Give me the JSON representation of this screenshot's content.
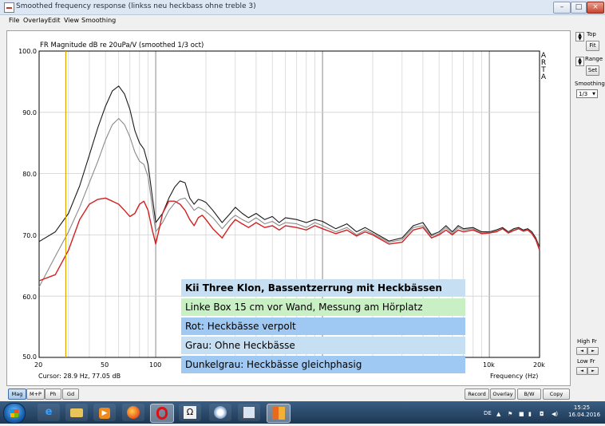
{
  "window": {
    "title": "Smoothed frequency response (linkss neu heckbass ohne treble 3)",
    "minimize": "–",
    "maximize": "□",
    "close": "×"
  },
  "menu": [
    "File",
    "Overlay",
    "Edit",
    "View",
    "Smoothing"
  ],
  "chart_data": {
    "type": "line",
    "title": "FR Magnitude dB re 20uPa/V (smoothed 1/3 oct)",
    "xlabel": "Frequency (Hz)",
    "ylabel": "",
    "x_scale": "log",
    "xlim": [
      20,
      20000
    ],
    "ylim": [
      50,
      100
    ],
    "ytick_labels": [
      "100.0",
      "90.0",
      "80.0",
      "70.0",
      "60.0",
      "50.0"
    ],
    "ytick_values": [
      100,
      90,
      80,
      70,
      60,
      50
    ],
    "xtick_labels": [
      "20",
      "50",
      "100",
      "10k",
      "20k"
    ],
    "xtick_values": [
      20,
      50,
      100,
      10000,
      20000
    ],
    "grid": true,
    "cursor_line_hz": 28.9,
    "series": [
      {
        "color": "#1a1a1a",
        "x": [
          20,
          25,
          30,
          35,
          40,
          45,
          50,
          55,
          60,
          65,
          70,
          75,
          80,
          85,
          90,
          100,
          110,
          120,
          130,
          140,
          150,
          160,
          170,
          180,
          190,
          200,
          220,
          250,
          280,
          300,
          330,
          360,
          400,
          450,
          500,
          550,
          600,
          700,
          800,
          900,
          1000,
          1200,
          1400,
          1600,
          1800,
          2000,
          2500,
          3000,
          3500,
          4000,
          4500,
          5000,
          5500,
          6000,
          6500,
          7000,
          8000,
          9000,
          10000,
          11000,
          12000,
          13000,
          14000,
          15000,
          16000,
          17000,
          18000,
          19000,
          20000
        ],
        "y": [
          68.9,
          70.5,
          73.5,
          78.0,
          83.0,
          87.5,
          91.0,
          93.5,
          94.3,
          93.0,
          90.5,
          87.0,
          85.0,
          84.0,
          81.5,
          72.0,
          73.5,
          76.0,
          77.8,
          78.8,
          78.5,
          76.0,
          75.0,
          75.8,
          75.6,
          75.3,
          74.0,
          72.0,
          73.5,
          74.5,
          73.5,
          72.8,
          73.5,
          72.5,
          73.0,
          72.0,
          72.8,
          72.5,
          72.0,
          72.5,
          72.2,
          71.0,
          71.8,
          70.5,
          71.2,
          70.5,
          69.0,
          69.5,
          71.5,
          72.0,
          70.0,
          70.5,
          71.5,
          70.5,
          71.5,
          71.0,
          71.2,
          70.5,
          70.5,
          70.8,
          71.2,
          70.5,
          71.0,
          71.2,
          70.8,
          71.0,
          70.5,
          69.5,
          68.0
        ]
      },
      {
        "color": "#8a8a8a",
        "x": [
          20,
          25,
          30,
          35,
          40,
          45,
          50,
          55,
          60,
          65,
          70,
          75,
          80,
          85,
          90,
          100,
          110,
          120,
          130,
          140,
          150,
          160,
          170,
          180,
          190,
          200,
          220,
          250,
          280,
          300,
          330,
          360,
          400,
          450,
          500,
          550,
          600,
          700,
          800,
          900,
          1000,
          1200,
          1400,
          1600,
          1800,
          2000,
          2500,
          3000,
          3500,
          4000,
          4500,
          5000,
          5500,
          6000,
          6500,
          7000,
          8000,
          9000,
          10000,
          11000,
          12000,
          13000,
          14000,
          15000,
          16000,
          17000,
          18000,
          19000,
          20000
        ],
        "y": [
          61.5,
          66.5,
          70.5,
          74.5,
          78.5,
          82.0,
          85.5,
          88.0,
          89.0,
          88.0,
          86.0,
          83.5,
          82.0,
          81.5,
          79.5,
          70.5,
          72.0,
          74.0,
          75.2,
          75.8,
          76.0,
          75.0,
          74.0,
          74.5,
          74.2,
          73.8,
          72.8,
          71.0,
          72.5,
          73.2,
          72.5,
          72.0,
          72.8,
          71.8,
          72.2,
          71.5,
          72.0,
          71.8,
          71.2,
          72.0,
          71.5,
          70.5,
          71.2,
          70.0,
          70.8,
          70.2,
          68.8,
          69.2,
          71.2,
          71.5,
          69.8,
          70.2,
          71.2,
          70.2,
          71.2,
          70.8,
          71.0,
          70.3,
          70.4,
          70.6,
          71.0,
          70.4,
          70.8,
          71.0,
          70.6,
          70.8,
          70.3,
          69.3,
          67.8
        ]
      },
      {
        "color": "#d42020",
        "x": [
          20,
          25,
          30,
          35,
          40,
          45,
          50,
          55,
          60,
          65,
          70,
          75,
          80,
          85,
          90,
          95,
          100,
          105,
          110,
          120,
          130,
          140,
          150,
          160,
          170,
          180,
          190,
          200,
          220,
          250,
          280,
          300,
          330,
          360,
          400,
          450,
          500,
          550,
          600,
          700,
          800,
          900,
          1000,
          1200,
          1400,
          1600,
          1800,
          2000,
          2500,
          3000,
          3500,
          4000,
          4500,
          5000,
          5500,
          6000,
          6500,
          7000,
          8000,
          9000,
          10000,
          11000,
          12000,
          13000,
          14000,
          15000,
          16000,
          17000,
          18000,
          19000,
          20000
        ],
        "y": [
          62.5,
          63.5,
          67.5,
          72.5,
          75.0,
          75.8,
          76.0,
          75.5,
          75.0,
          74.0,
          73.0,
          73.5,
          75.0,
          75.5,
          74.0,
          71.0,
          68.5,
          71.0,
          73.5,
          75.5,
          75.5,
          75.0,
          74.0,
          72.5,
          71.5,
          72.8,
          73.2,
          72.5,
          71.0,
          69.5,
          71.5,
          72.5,
          71.8,
          71.2,
          72.0,
          71.2,
          71.5,
          70.8,
          71.5,
          71.2,
          70.8,
          71.5,
          71.0,
          70.2,
          70.8,
          69.8,
          70.5,
          70.0,
          68.5,
          68.8,
          70.8,
          71.2,
          69.5,
          70.0,
          70.8,
          70.0,
          70.8,
          70.5,
          70.8,
          70.2,
          70.3,
          70.5,
          71.0,
          70.3,
          70.7,
          71.0,
          70.6,
          70.8,
          70.2,
          69.2,
          67.5
        ]
      }
    ]
  },
  "plot": {
    "arta_letters": [
      "A",
      "R",
      "T",
      "A"
    ],
    "cursor_readout": "Cursor: 28.9 Hz, 77.05 dB",
    "annotations": [
      "Kii Three Klon, Bassentzerrung mit Heckbässen",
      "Linke Box 15 cm vor Wand, Messung am Hörplatz",
      "Rot: Heckbässe verpolt",
      "Grau: Ohne Heckbässe",
      "Dunkelgrau: Heckbässe gleichphasig"
    ]
  },
  "right_panel": {
    "top_label": "Top",
    "fit_label": "Fit",
    "range_label": "Range",
    "set_label": "Set",
    "smoothing_label": "Smoothing",
    "smoothing_value": "1/3",
    "high_fr_label": "High Fr",
    "low_fr_label": "Low Fr"
  },
  "bottom_tabs": [
    "Mag",
    "M+P",
    "Ph",
    "Gd"
  ],
  "bottom_buttons": [
    "Record",
    "Overlay",
    "B/W",
    "Copy"
  ],
  "taskbar": {
    "language": "DE",
    "time": "15:25",
    "date": "16.04.2016",
    "apps": [
      "ie-icon",
      "explorer-icon",
      "media-player-icon",
      "firefox-icon",
      "opera-icon",
      "omega-icon",
      "paint-icon",
      "app-icon",
      "office-icon"
    ]
  },
  "colors": {
    "cursor_line": "#e0a800",
    "grid_minor": "#d0d0d0",
    "grid_major": "#8a8a8a",
    "annotation_blue": "#9fc8f2",
    "annotation_lightblue": "#c7dff2",
    "annotation_green": "#c9f0c4"
  }
}
